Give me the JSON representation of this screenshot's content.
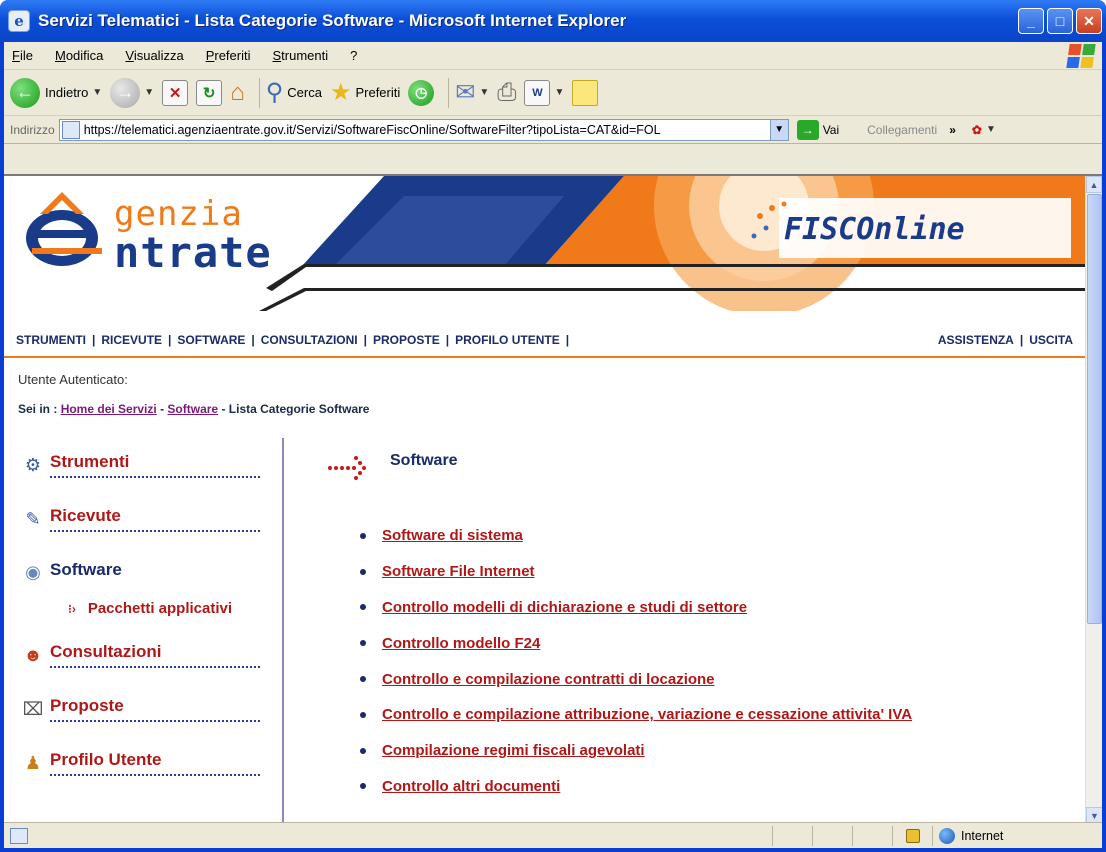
{
  "window": {
    "title": "Servizi Telematici - Lista Categorie Software - Microsoft Internet Explorer"
  },
  "menu": [
    "File",
    "Modifica",
    "Visualizza",
    "Preferiti",
    "Strumenti",
    "?"
  ],
  "toolbar": {
    "back_label": "Indietro",
    "search_label": "Cerca",
    "favorites_label": "Preferiti"
  },
  "address": {
    "label": "Indirizzo",
    "url": "https://telematici.agenziaentrate.gov.it/Servizi/SoftwareFiscOnline/SoftwareFilter?tipoLista=CAT&id=FOL",
    "go_label": "Vai",
    "links_label": "Collegamenti"
  },
  "banner": {
    "logo_line1": "genzia",
    "logo_line2": "ntrate",
    "fisco": "FISCOnline"
  },
  "nav": {
    "left": [
      "STRUMENTI",
      "RICEVUTE",
      "SOFTWARE",
      "CONSULTAZIONI",
      "PROPOSTE",
      "PROFILO UTENTE"
    ],
    "right": [
      "ASSISTENZA",
      "USCITA"
    ]
  },
  "auth_text": "Utente Autenticato:",
  "breadcrumb": {
    "prefix": "Sei in :",
    "home": "Home dei Servizi",
    "software": "Software",
    "current": "- Lista Categorie Software"
  },
  "sidebar": {
    "items": [
      {
        "label": "Strumenti",
        "icon": "gear-icon"
      },
      {
        "label": "Ricevute",
        "icon": "receipt-icon"
      },
      {
        "label": "Software",
        "icon": "cd-icon"
      },
      {
        "label": "Consultazioni",
        "icon": "consult-icon"
      },
      {
        "label": "Proposte",
        "icon": "proposal-icon"
      },
      {
        "label": "Profilo Utente",
        "icon": "users-icon"
      }
    ],
    "sub_item": "Pacchetti applicativi"
  },
  "main": {
    "title": "Software",
    "links": [
      "Software di sistema",
      "Software File Internet",
      "Controllo modelli di dichiarazione e studi di settore",
      "Controllo modello F24",
      "Controllo e compilazione contratti di locazione",
      "Controllo e compilazione attribuzione, variazione e cessazione attivita' IVA",
      "Compilazione regimi fiscali agevolati",
      "Controllo altri documenti"
    ]
  },
  "status": {
    "zone": "Internet"
  },
  "colors": {
    "link_red": "#b01818",
    "navy": "#1a2a6a",
    "orange": "#f07a1a",
    "title_blue": "#0a44c8"
  }
}
